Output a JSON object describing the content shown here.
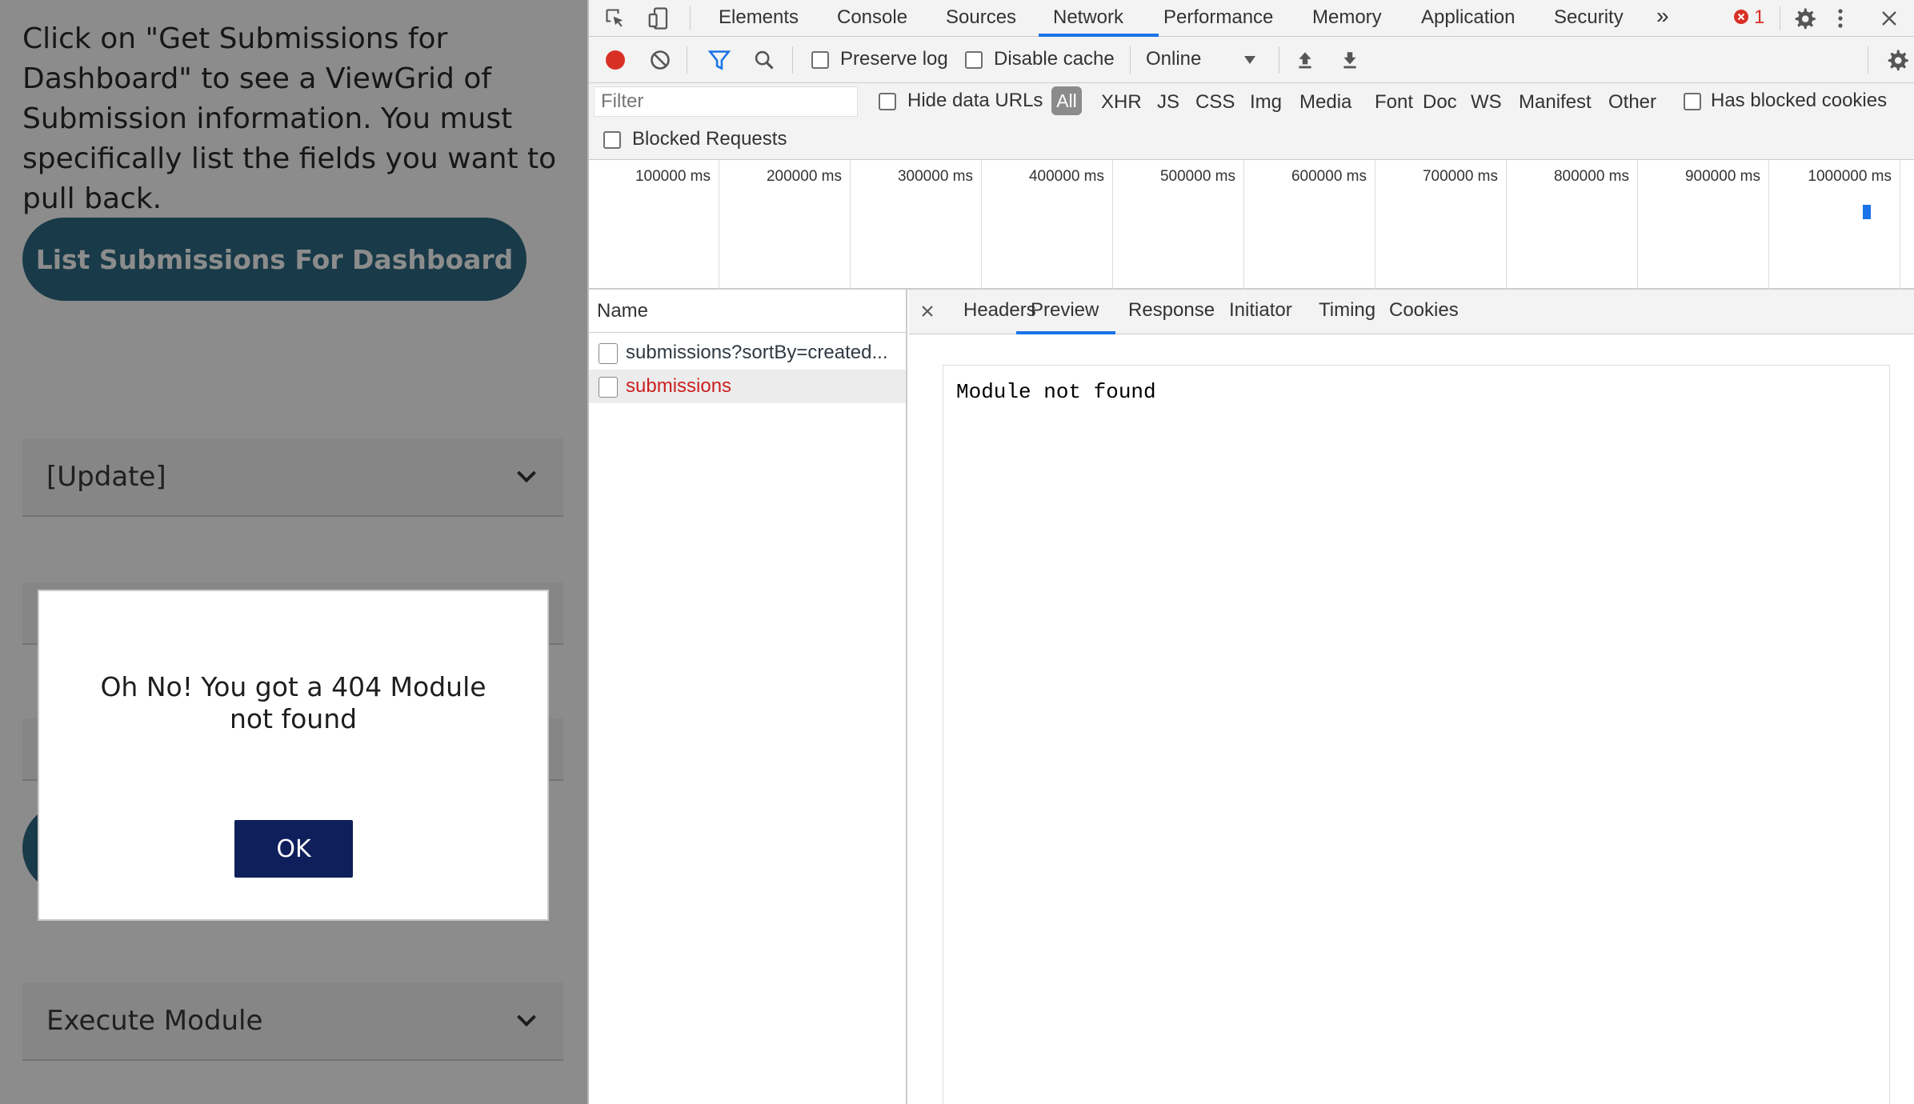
{
  "app": {
    "intro_text": "Click on \"Get Submissions for Dashboard\" to see a ViewGrid of Submission information. You must specifically list the fields you want to pull back.",
    "primary_button_label": "List Submissions For Dashboard",
    "accordion_update_label": "[Update]",
    "accordion_execute_label": "Execute Module",
    "modal": {
      "message": "Oh No! You got a 404 Module not found",
      "ok_label": "OK"
    }
  },
  "devtools": {
    "tabs": [
      "Elements",
      "Console",
      "Sources",
      "Network",
      "Performance",
      "Memory",
      "Application",
      "Security"
    ],
    "active_tab": "Network",
    "more_tabs_glyph": "»",
    "error_count": "1",
    "toolbar": {
      "preserve_log_label": "Preserve log",
      "disable_cache_label": "Disable cache",
      "throttling_value": "Online"
    },
    "filter": {
      "placeholder": "Filter",
      "hide_data_urls_label": "Hide data URLs",
      "types": [
        "All",
        "XHR",
        "JS",
        "CSS",
        "Img",
        "Media",
        "Font",
        "Doc",
        "WS",
        "Manifest",
        "Other"
      ],
      "active_type": "All",
      "has_blocked_cookies_label": "Has blocked cookies",
      "blocked_requests_label": "Blocked Requests"
    },
    "overview_ticks": [
      "100000 ms",
      "200000 ms",
      "300000 ms",
      "400000 ms",
      "500000 ms",
      "600000 ms",
      "700000 ms",
      "800000 ms",
      "900000 ms",
      "1000000 ms"
    ],
    "name_header": "Name",
    "requests": [
      {
        "name": "submissions?sortBy=created...",
        "status": "ok",
        "selected": false
      },
      {
        "name": "submissions",
        "status": "error",
        "selected": true
      }
    ],
    "detail_tabs": [
      "Headers",
      "Preview",
      "Response",
      "Initiator",
      "Timing",
      "Cookies"
    ],
    "active_detail_tab": "Preview",
    "preview_text": "Module not found"
  },
  "colors": {
    "accent": "#1a73e8",
    "record_red": "#d93025",
    "error_text": "#cc1f1f",
    "app_button": "#2f6b83",
    "modal_ok": "#0e1f5b"
  }
}
